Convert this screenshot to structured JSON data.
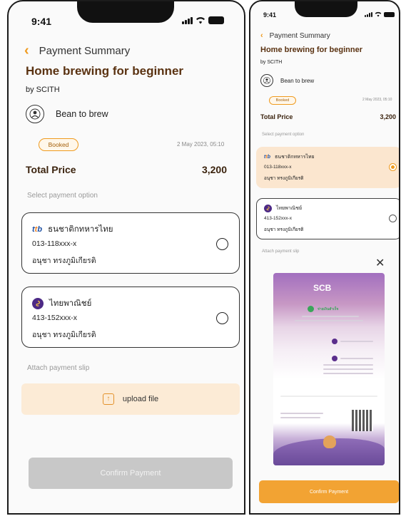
{
  "status_bar": {
    "time": "9:41"
  },
  "header": {
    "back_label": "Payment Summary"
  },
  "course": {
    "title": "Home brewing for beginner",
    "by": "by SCITH",
    "organizer": "Bean to brew"
  },
  "booking": {
    "status": "Booked",
    "date": "2 May 2023, 05:10"
  },
  "total": {
    "label": "Total Price",
    "value": "3,200"
  },
  "payment": {
    "section_label": "Select payment option",
    "options": [
      {
        "bank": "ธนชาติกทหารไทย",
        "account": "013-118xxx-x",
        "name": "อนุชา ทรงภูมิเกียรติ",
        "logo": "ttb-logo-icon"
      },
      {
        "bank": "ไทยพาณิชย์",
        "account": "413-152xxx-x",
        "name": "อนุชา ทรงภูมิเกียรติ",
        "logo": "scb-logo-icon"
      }
    ],
    "screen_a_selected": null,
    "screen_b_selected": 0
  },
  "attach": {
    "label": "Attach payment slip",
    "upload_label": "upload file"
  },
  "confirm": {
    "label": "Confirm Payment"
  },
  "slip": {
    "brand": "SCB",
    "status": "จ่ายเงินสำเร็จ"
  },
  "colors": {
    "accent": "#ef9a1e",
    "title_brown": "#5a3211",
    "selected_bg": "#fbe6cf",
    "disabled_button": "#c8c8c8",
    "active_button": "#f2a333"
  }
}
